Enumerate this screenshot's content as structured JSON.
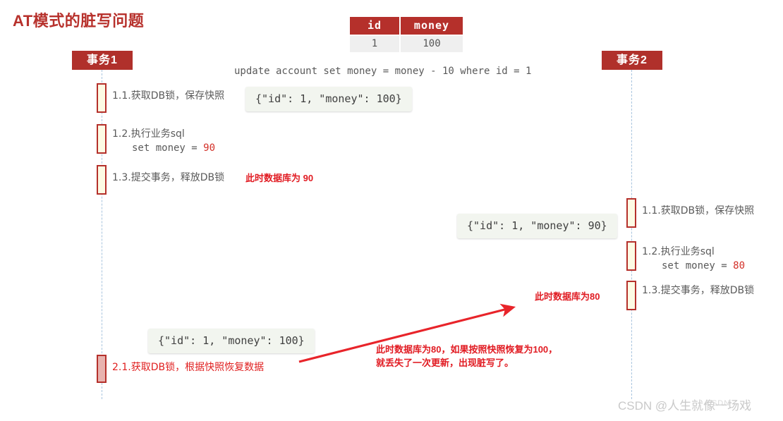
{
  "title": "AT模式的脏写问题",
  "colors": {
    "brand_red": "#b5302b",
    "annotation_red": "#e11b22",
    "lifeline_blue": "#a8c4de",
    "activation_fill": "#fdfbe4",
    "restore_fill": "#e8b3af",
    "json_box_bg": "#f2f5ef"
  },
  "table": {
    "headers": [
      "id",
      "money"
    ],
    "rows": [
      [
        "1",
        "100"
      ]
    ]
  },
  "sql_statement": "update account set money = money - 10 where id = 1",
  "actors": [
    {
      "name": "事务1"
    },
    {
      "name": "事务2"
    }
  ],
  "tx1": {
    "steps": [
      {
        "label": "1.1.获取DB锁，保存快照",
        "sql": ""
      },
      {
        "label": "1.2.执行业务sql",
        "sql": "set money = ",
        "value": "90"
      },
      {
        "label": "1.3.提交事务，释放DB锁",
        "sql": ""
      }
    ],
    "restore_step": {
      "label": "2.1.获取DB锁，根据快照恢复数据"
    },
    "note_after_commit": "此时数据库为 90",
    "snapshot_box": "{\"id\": 1, \"money\": 100}",
    "restore_box": "{\"id\": 1, \"money\": 100}"
  },
  "tx2": {
    "steps": [
      {
        "label": "1.1.获取DB锁，保存快照",
        "sql": ""
      },
      {
        "label": "1.2.执行业务sql",
        "sql": "set money = ",
        "value": "80"
      },
      {
        "label": "1.3.提交事务，释放DB锁",
        "sql": ""
      }
    ],
    "snapshot_box": "{\"id\": 1, \"money\": 90}",
    "note_after_commit": "此时数据库为80"
  },
  "conclusion": {
    "line1": "此时数据库为80，如果按照快照恢复为100，",
    "line2": "就丢失了一次更新，出现脏写了。"
  },
  "watermark": {
    "text": "CSDN @人生就像一场戏",
    "logo": "CSDN"
  }
}
